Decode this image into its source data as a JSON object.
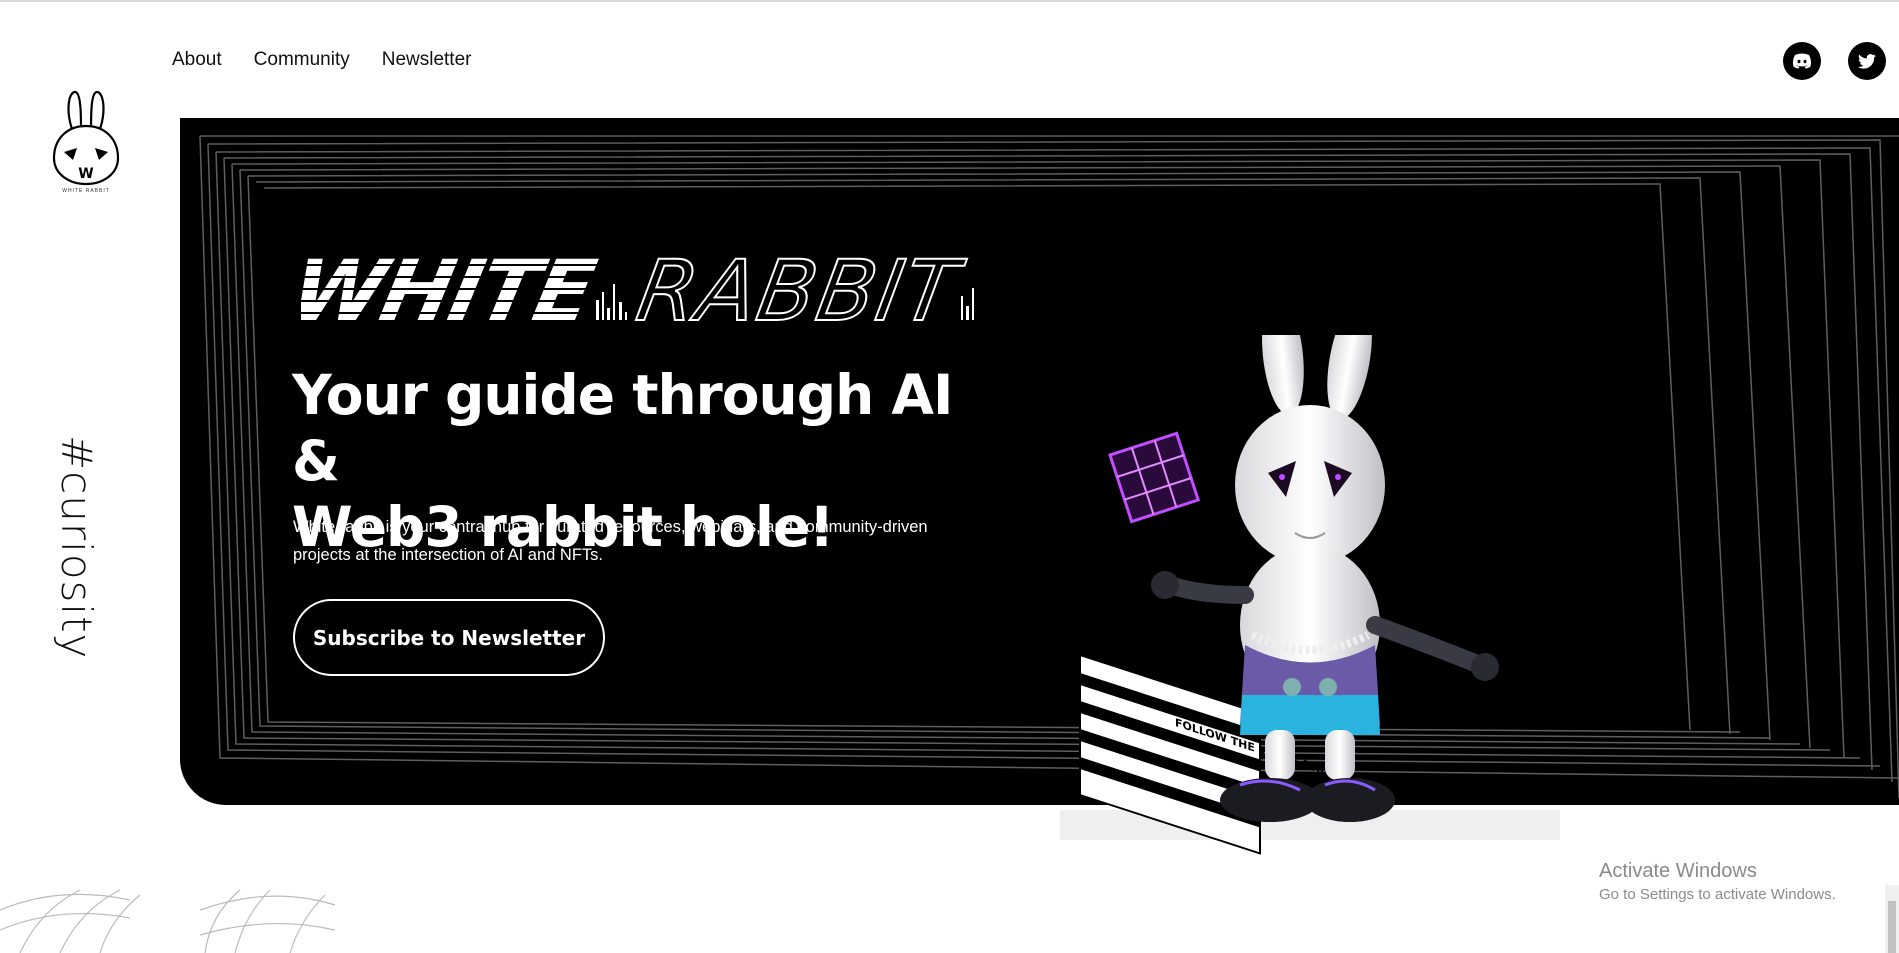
{
  "nav": {
    "links": [
      "About",
      "Community",
      "Newsletter"
    ]
  },
  "social": {
    "discord_icon": "discord-icon",
    "twitter_icon": "twitter-icon"
  },
  "logo": {
    "text": "WHITE RABBIT",
    "letter": "W"
  },
  "sidebar": {
    "hashtag": "#curiosity"
  },
  "hero": {
    "brand_left": "WHITE",
    "brand_right": "RABBIT",
    "headline_line1": "Your guide through AI &",
    "headline_line2": "Web3 rabbit hole!",
    "description": "White rabbit is your central hub for curated resources, webinars, and community-driven projects at the intersection of AI and NFTs.",
    "cta_label": "Subscribe to Newsletter"
  },
  "mascot": {
    "box_text": "FOLLOW THE WHITE RABBIT"
  },
  "windows_notice": {
    "title": "Activate Windows",
    "subtitle": "Go to Settings to activate Windows."
  },
  "colors": {
    "hero_bg": "#000000",
    "accent_purple": "#c04dff",
    "shorts_blue": "#2bb3e0"
  }
}
